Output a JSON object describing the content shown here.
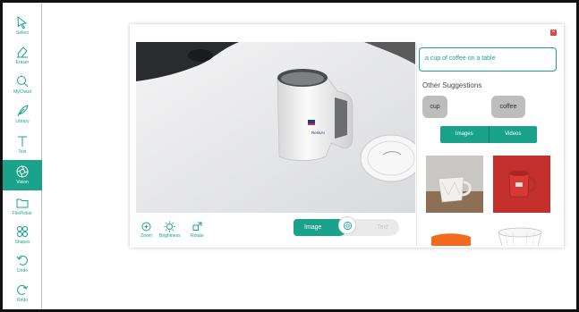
{
  "sidebar": {
    "tools": [
      {
        "label": "Select",
        "icon": "cursor-icon"
      },
      {
        "label": "Eraser",
        "icon": "eraser-icon"
      },
      {
        "label": "MyCloud",
        "icon": "search-icon"
      },
      {
        "label": "Library",
        "icon": "feather-icon"
      },
      {
        "label": "Text",
        "icon": "text-icon"
      },
      {
        "label": "Vision",
        "icon": "aperture-icon"
      },
      {
        "label": "FilePicker",
        "icon": "folder-icon"
      },
      {
        "label": "Shapes",
        "icon": "shapes-icon"
      },
      {
        "label": "Undo",
        "icon": "undo-icon"
      },
      {
        "label": "Redo",
        "icon": "redo-icon"
      }
    ],
    "active_tool": "Vision"
  },
  "panel": {
    "close_label": "×",
    "controls": {
      "zoom": "Zoom",
      "brightness": "Brightness",
      "rotate": "Rotate"
    },
    "toggle": {
      "image_label": "Image",
      "text_label": "Text"
    }
  },
  "suggestions": {
    "query": "a cup of coffee on a table",
    "other_title": "Other Suggestions",
    "chips": [
      "cup",
      "coffee"
    ],
    "tabs": [
      "Images",
      "Videos"
    ]
  },
  "colors": {
    "accent": "#1aa38a",
    "close": "#e0443f"
  }
}
